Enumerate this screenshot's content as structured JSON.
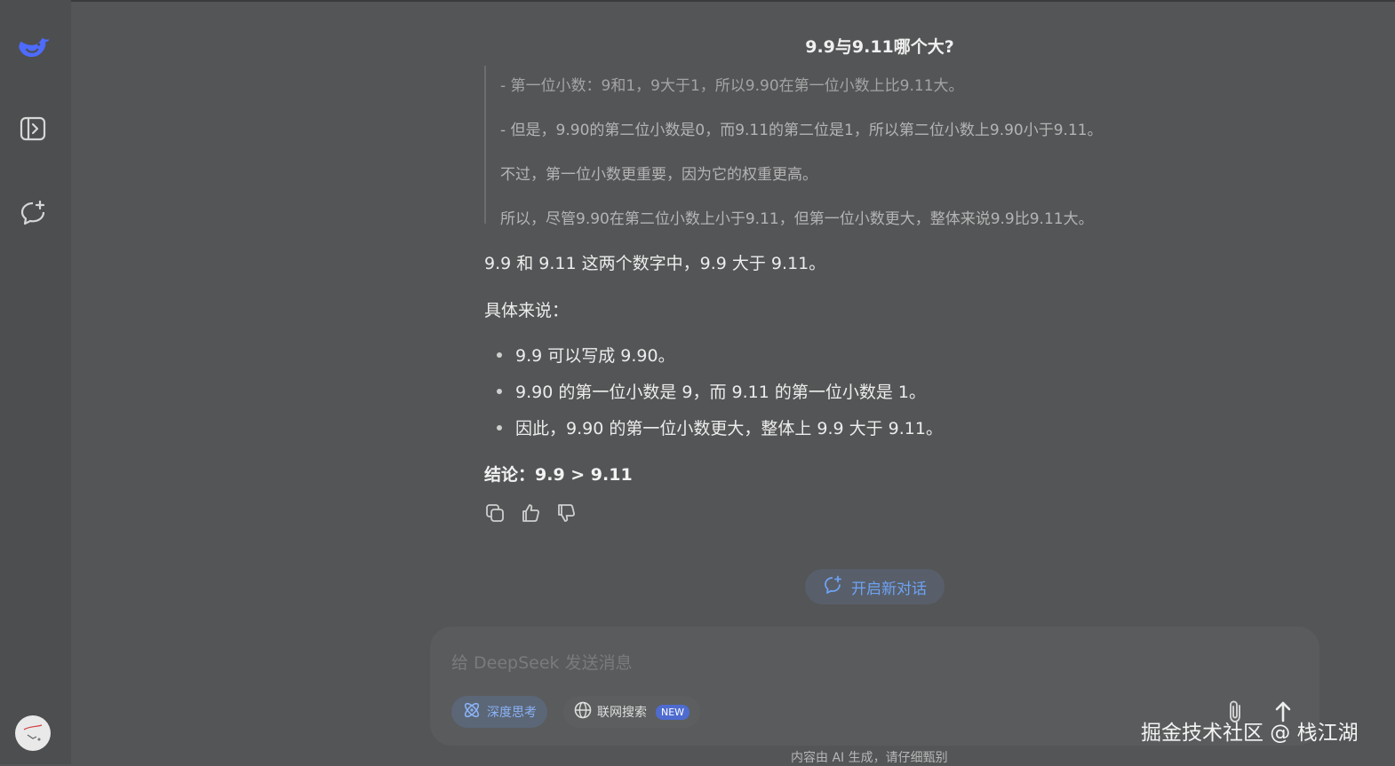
{
  "conversation": {
    "title": "9.9与9.11哪个大?"
  },
  "thinking": {
    "lines": [
      "- 第一位小数：9和1，9大于1，所以9.90在第一位小数上比9.11大。",
      "- 但是，9.90的第二位小数是0，而9.11的第二位是1，所以第二位小数上9.90小于9.11。",
      "不过，第一位小数更重要，因为它的权重更高。",
      "所以，尽管9.90在第二位小数上小于9.11，但第一位小数更大，整体来说9.9比9.11大。"
    ]
  },
  "answer": {
    "intro": "9.9 和 9.11 这两个数字中，9.9 大于 9.11。",
    "detail_heading": "具体来说：",
    "bullets": [
      "9.9 可以写成 9.90。",
      "9.90 的第一位小数是 9，而 9.11 的第一位小数是 1。",
      "因此，9.90 的第一位小数更大，整体上 9.9 大于 9.11。"
    ],
    "conclusion": "结论：9.9 > 9.11"
  },
  "actions": {
    "copy_icon": "copy-icon",
    "like_icon": "thumbs-up-icon",
    "dislike_icon": "thumbs-down-icon"
  },
  "new_chat_button": {
    "label": "开启新对话"
  },
  "input": {
    "placeholder": "给 DeepSeek 发送消息",
    "deep_think_label": "深度思考",
    "web_search_label": "联网搜索",
    "web_search_badge": "NEW"
  },
  "footer": {
    "disclaimer": "内容由 AI 生成，请仔细甄别"
  },
  "watermark": {
    "text": "掘金技术社区 @ 栈江湖"
  },
  "colors": {
    "accent": "#6ea2f3",
    "background": "#545556",
    "sidebar": "#4d4e4f"
  }
}
